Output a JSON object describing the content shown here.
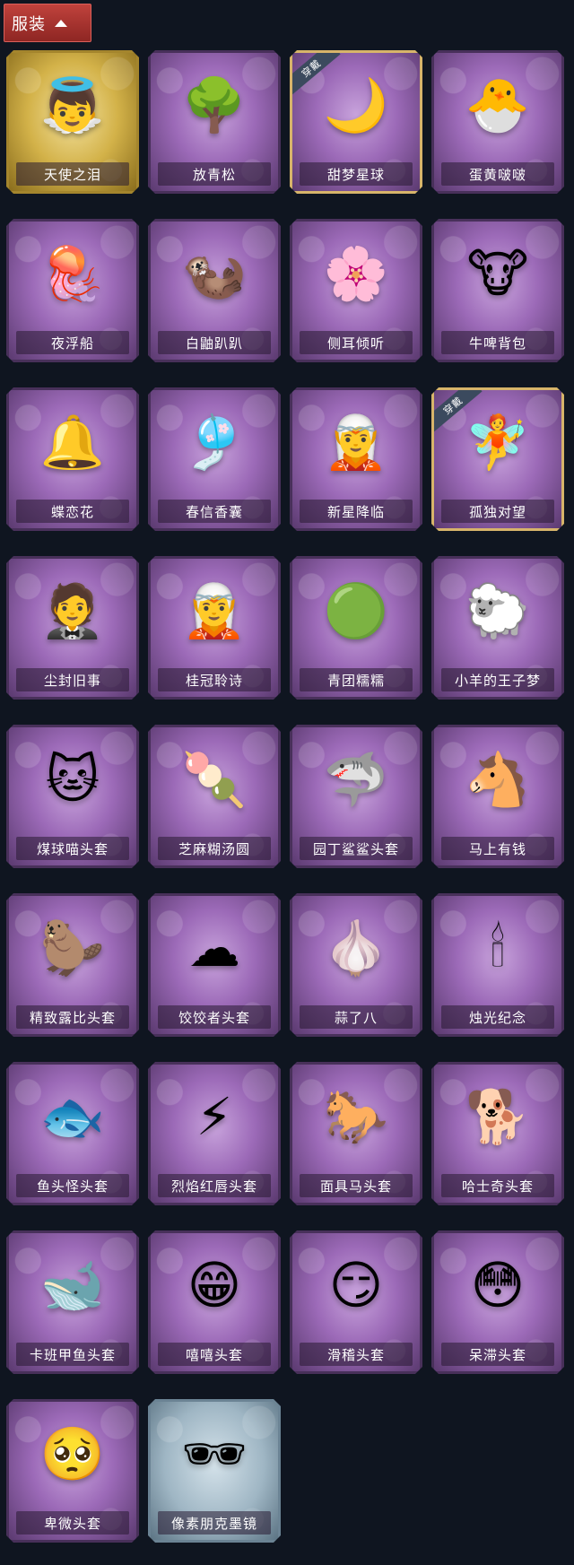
{
  "header": {
    "label": "服装"
  },
  "items": [
    {
      "name": "天使之泪",
      "icon": "angel-icon",
      "glyph": "👼",
      "style": "gold",
      "equipped": false
    },
    {
      "name": "放青松",
      "icon": "bonsai-icon",
      "glyph": "🌳",
      "style": "purple",
      "equipped": false
    },
    {
      "name": "甜梦星球",
      "icon": "moon-icon",
      "glyph": "🌙",
      "style": "purple",
      "equipped": true
    },
    {
      "name": "蛋黄啵啵",
      "icon": "chick-icon",
      "glyph": "🐣",
      "style": "purple",
      "equipped": false
    },
    {
      "name": "夜浮船",
      "icon": "jellyfish-icon",
      "glyph": "🪼",
      "style": "purple",
      "equipped": false
    },
    {
      "name": "白鼬趴趴",
      "icon": "ferret-icon",
      "glyph": "🦦",
      "style": "purple",
      "equipped": false
    },
    {
      "name": "侧耳倾听",
      "icon": "flower-wreath-icon",
      "glyph": "🌸",
      "style": "purple",
      "equipped": false
    },
    {
      "name": "牛啤背包",
      "icon": "cow-mug-icon",
      "glyph": "🐮",
      "style": "purple",
      "equipped": false
    },
    {
      "name": "蝶恋花",
      "icon": "bell-icon",
      "glyph": "🔔",
      "style": "purple",
      "equipped": false
    },
    {
      "name": "春信香囊",
      "icon": "sachet-icon",
      "glyph": "🎐",
      "style": "purple",
      "equipped": false
    },
    {
      "name": "新星降临",
      "icon": "doll-icon",
      "glyph": "🧝",
      "style": "purple",
      "equipped": false
    },
    {
      "name": "孤独对望",
      "icon": "doll-icon",
      "glyph": "🧚",
      "style": "purple",
      "equipped": true
    },
    {
      "name": "尘封旧事",
      "icon": "doll-icon",
      "glyph": "🤵",
      "style": "purple",
      "equipped": false
    },
    {
      "name": "桂冠聆诗",
      "icon": "doll-icon",
      "glyph": "🧝",
      "style": "purple",
      "equipped": false
    },
    {
      "name": "青团糯糯",
      "icon": "green-mochi-icon",
      "glyph": "🟢",
      "style": "purple",
      "equipped": false
    },
    {
      "name": "小羊的王子梦",
      "icon": "sheep-icon",
      "glyph": "🐑",
      "style": "purple",
      "equipped": false
    },
    {
      "name": "煤球喵头套",
      "icon": "cat-icon",
      "glyph": "🐱",
      "style": "purple",
      "equipped": false
    },
    {
      "name": "芝麻糊汤圆",
      "icon": "dumpling-icon",
      "glyph": "🍡",
      "style": "purple",
      "equipped": false
    },
    {
      "name": "园丁鲨鲨头套",
      "icon": "shark-icon",
      "glyph": "🦈",
      "style": "purple",
      "equipped": false
    },
    {
      "name": "马上有钱",
      "icon": "horse-icon",
      "glyph": "🐴",
      "style": "purple",
      "equipped": false
    },
    {
      "name": "精致露比头套",
      "icon": "beaver-icon",
      "glyph": "🦫",
      "style": "purple",
      "equipped": false
    },
    {
      "name": "饺饺者头套",
      "icon": "cloud-icon",
      "glyph": "☁",
      "style": "purple",
      "equipped": false
    },
    {
      "name": "蒜了八",
      "icon": "garlic-icon",
      "glyph": "🧄",
      "style": "purple",
      "equipped": false
    },
    {
      "name": "烛光纪念",
      "icon": "candle-icon",
      "glyph": "🕯",
      "style": "purple",
      "equipped": false
    },
    {
      "name": "鱼头怪头套",
      "icon": "fish-icon",
      "glyph": "🐟",
      "style": "purple",
      "equipped": false
    },
    {
      "name": "烈焰红唇头套",
      "icon": "pikachu-icon",
      "glyph": "⚡",
      "style": "purple",
      "equipped": false
    },
    {
      "name": "面具马头套",
      "icon": "horse-head-icon",
      "glyph": "🐎",
      "style": "purple",
      "equipped": false
    },
    {
      "name": "哈士奇头套",
      "icon": "dog-icon",
      "glyph": "🐕",
      "style": "purple",
      "equipped": false
    },
    {
      "name": "卡班甲鱼头套",
      "icon": "whale-icon",
      "glyph": "🐋",
      "style": "purple",
      "equipped": false
    },
    {
      "name": "嘻嘻头套",
      "icon": "grin-emoji-icon",
      "glyph": "😁",
      "style": "purple",
      "equipped": false
    },
    {
      "name": "滑稽头套",
      "icon": "smirk-emoji-icon",
      "glyph": "😏",
      "style": "purple",
      "equipped": false
    },
    {
      "name": "呆滞头套",
      "icon": "stare-emoji-icon",
      "glyph": "😳",
      "style": "purple",
      "equipped": false
    },
    {
      "name": "卑微头套",
      "icon": "pleading-emoji-icon",
      "glyph": "🥺",
      "style": "purple",
      "equipped": false
    },
    {
      "name": "像素朋克墨镜",
      "icon": "sunglasses-icon",
      "glyph": "🕶",
      "style": "blue",
      "equipped": false
    }
  ],
  "badge_label": "穿戴"
}
